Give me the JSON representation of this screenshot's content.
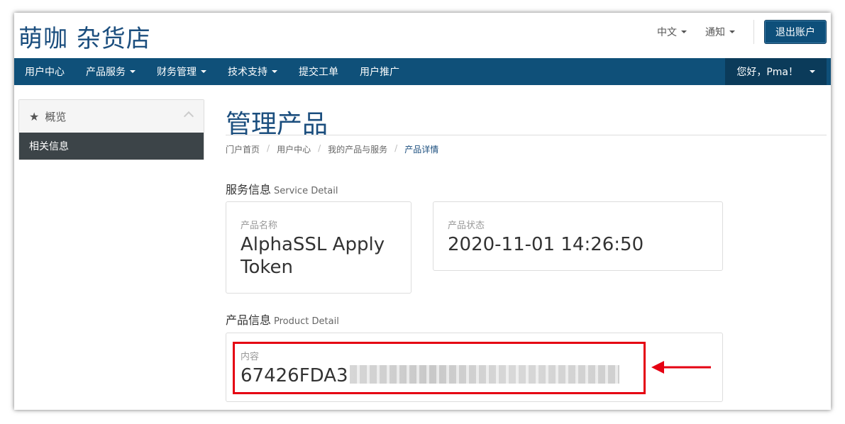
{
  "header": {
    "logo": "萌咖 杂货店",
    "lang_label": "中文",
    "notify_label": "通知",
    "logout_label": "退出账户"
  },
  "nav": {
    "items": [
      {
        "label": "用户中心",
        "dropdown": false
      },
      {
        "label": "产品服务",
        "dropdown": true
      },
      {
        "label": "财务管理",
        "dropdown": true
      },
      {
        "label": "技术支持",
        "dropdown": true
      },
      {
        "label": "提交工单",
        "dropdown": false
      },
      {
        "label": "用户推广",
        "dropdown": false
      }
    ],
    "user_label": "您好，Pma！"
  },
  "sidebar": {
    "header": "概览",
    "items": [
      {
        "label": "相关信息"
      }
    ]
  },
  "main": {
    "title": "管理产品",
    "breadcrumb": [
      "门户首页",
      "用户中心",
      "我的产品与服务",
      "产品详情"
    ],
    "service_section": {
      "title": "服务信息",
      "subtitle": "Service Detail"
    },
    "product_name": {
      "label": "产品名称",
      "value": "AlphaSSL Apply Token"
    },
    "product_status": {
      "label": "产品状态",
      "value": "2020-11-01 14:26:50"
    },
    "product_section": {
      "title": "产品信息",
      "subtitle": "Product Detail"
    },
    "content": {
      "label": "内容",
      "value": "67426FDA3"
    }
  },
  "colors": {
    "brand": "#1b4e7e",
    "nav_bg": "#0f5079",
    "highlight": "#e50012"
  }
}
